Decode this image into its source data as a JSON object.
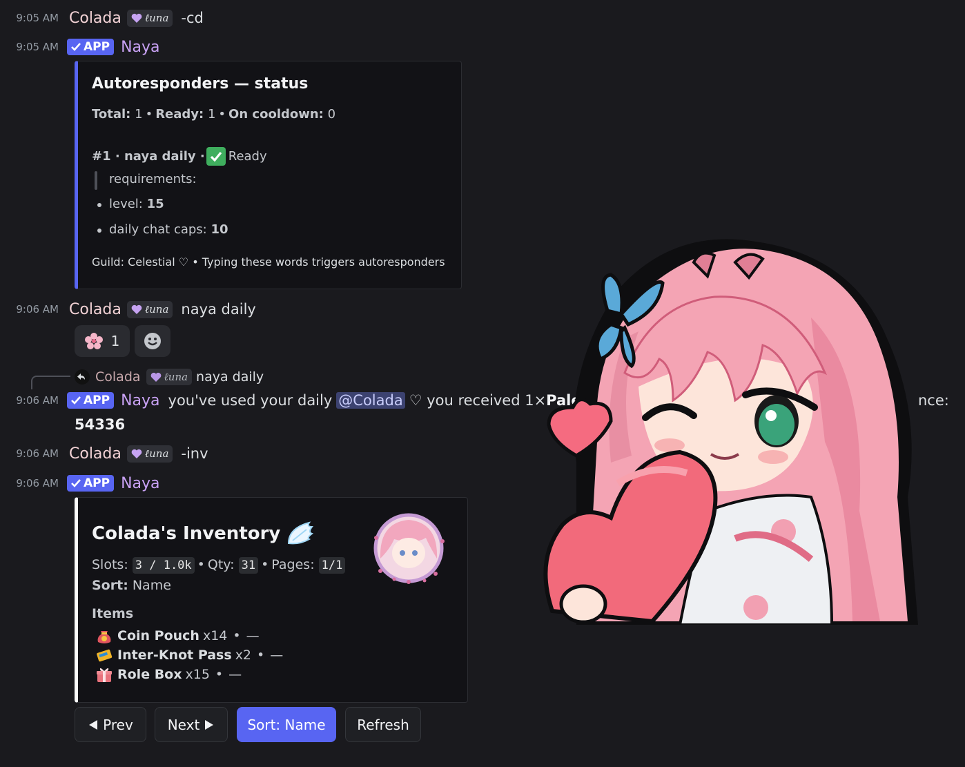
{
  "colors": {
    "accent": "#5865f2",
    "app_badge": "#5865f2",
    "naya_name": "#c9a2f5",
    "colada_name": "#f2d2d5",
    "check_green": "#3fae5e"
  },
  "tag_label": "ℓuna",
  "app_label": "APP",
  "messages": [
    {
      "time": "9:05 AM",
      "author": "Colada",
      "text": "-cd"
    },
    {
      "time": "9:05 AM",
      "author": "Naya"
    },
    {
      "time": "9:06 AM",
      "author": "Colada",
      "text": "naya daily"
    },
    {
      "time": "9:06 AM",
      "author": "Naya",
      "text_pre": "you've used your daily",
      "mention": "@Colada",
      "text_post": "♡ you received 1× ",
      "text_bold": "Pale",
      "text_tail": "nce:",
      "balance": "54336"
    },
    {
      "time": "9:06 AM",
      "author": "Colada",
      "text": "-inv"
    },
    {
      "time": "9:06 AM",
      "author": "Naya"
    }
  ],
  "embed_status": {
    "title": "Autoresponders — status",
    "total_label": "Total:",
    "total": "1",
    "ready_label": "Ready:",
    "ready": "1",
    "cooldown_label": "On cooldown:",
    "cooldown": "0",
    "item_prefix": "#1 · naya daily ·",
    "item_status": "Ready",
    "requirements_label": "requirements:",
    "req_level_label": "level:",
    "req_level": "15",
    "req_caps_label": "daily chat caps:",
    "req_caps": "10",
    "footer": "Guild: Celestial ♡ • Typing these words triggers autoresponders"
  },
  "reactions": {
    "flower_count": "1"
  },
  "reply": {
    "author": "Colada",
    "text": "naya daily"
  },
  "embed_inventory": {
    "title": "Colada's Inventory",
    "slots_label": "Slots:",
    "slots": "3 / 1.0k",
    "qty_label": "Qty:",
    "qty": "31",
    "pages_label": "Pages:",
    "pages": "1/1",
    "sort_label": "Sort:",
    "sort": "Name",
    "items_header": "Items",
    "items": [
      {
        "icon": "coin-pouch-icon",
        "name": "Coin Pouch",
        "qty": "x14",
        "desc": "—"
      },
      {
        "icon": "pass-icon",
        "name": "Inter-Knot Pass",
        "qty": "x2",
        "desc": "—"
      },
      {
        "icon": "gift-icon",
        "name": "Role Box",
        "qty": "x15",
        "desc": "—"
      }
    ]
  },
  "buttons": {
    "prev": "Prev",
    "next": "Next",
    "sort": "Sort: Name",
    "refresh": "Refresh"
  },
  "dot": "•"
}
